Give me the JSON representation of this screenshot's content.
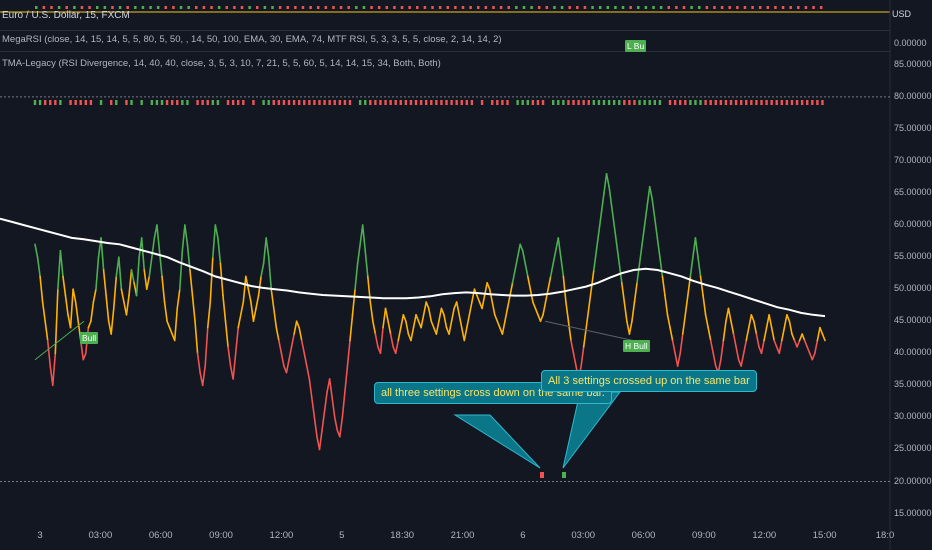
{
  "header": {
    "symbol_line": "Euro / U.S. Dollar, 15, FXCM",
    "indicator1": "MegaRSI (close, 14, 15, 14, 5, 5, 80, 5, 50, , 14, 50, 100, EMA, 30, EMA, 74, MTF RSI, 5, 3, 3, 5, 5, close, 2, 14, 14, 2)",
    "indicator2": "TMA-Legacy (RSI Divergence, 14, 40, 40, close, 3, 5, 3, 10, 7, 21, 5, 5, 60, 5, 14, 14, 15, 34, Both, Both)",
    "currency": "USD",
    "pane2_value": "0.00000"
  },
  "colors": {
    "background": "#131722",
    "ma_line": "#ffffff",
    "bull": "#4caf50",
    "bear": "#f05350",
    "rsi_mid": "#ffb300",
    "callout_bg": "#0c7689",
    "callout_text": "#f5e56b"
  },
  "callouts": {
    "down": "all three settings cross down on the same bar.",
    "up": "All 3 settings crossed up on the same bar"
  },
  "labels": {
    "bull1": "Bull",
    "bull2": "H Bull",
    "bull_top": "L Bu"
  },
  "chart_data": {
    "type": "line",
    "yticks": [
      "85.00000",
      "80.00000",
      "75.00000",
      "70.00000",
      "65.00000",
      "60.00000",
      "55.00000",
      "50.00000",
      "45.00000",
      "40.00000",
      "35.00000",
      "30.00000",
      "25.00000",
      "20.00000",
      "15.00000"
    ],
    "ytick_values": [
      85,
      80,
      75,
      70,
      65,
      60,
      55,
      50,
      45,
      40,
      35,
      30,
      25,
      20,
      15
    ],
    "xticks": [
      "3",
      "03:00",
      "06:00",
      "09:00",
      "12:00",
      "5",
      "18:30",
      "21:00",
      "6",
      "03:00",
      "06:00",
      "09:00",
      "12:00",
      "15:00",
      "18:0"
    ],
    "ylim": [
      14,
      87
    ],
    "hlines": [
      80,
      20
    ],
    "series": [
      {
        "kind": "rsi",
        "values": [
          57,
          55,
          52,
          48,
          45,
          42,
          38,
          35,
          40,
          50,
          56,
          52,
          49,
          46,
          44,
          50,
          48,
          45,
          42,
          39,
          40,
          44,
          45,
          48,
          50,
          55,
          58,
          53,
          49,
          45,
          43,
          47,
          52,
          55,
          50,
          48,
          46,
          49,
          53,
          51,
          49,
          55,
          58,
          53,
          50,
          52,
          55,
          58,
          60,
          56,
          52,
          48,
          45,
          44,
          43,
          42,
          47,
          50,
          56,
          60,
          57,
          53,
          49,
          45,
          40,
          37,
          35,
          38,
          44,
          48,
          55,
          60,
          58,
          54,
          49,
          45,
          41,
          38,
          36,
          40,
          44,
          46,
          48,
          52,
          50,
          48,
          45,
          47,
          49,
          52,
          54,
          58,
          55,
          50,
          47,
          44,
          42,
          40,
          38,
          37,
          39,
          41,
          43,
          45,
          44,
          42,
          40,
          38,
          36,
          33,
          30,
          27,
          25,
          28,
          31,
          34,
          36,
          33,
          30,
          28,
          27,
          30,
          34,
          38,
          42,
          46,
          50,
          54,
          57,
          60,
          56,
          52,
          48,
          45,
          43,
          41,
          40,
          44,
          47,
          45,
          43,
          41,
          40,
          42,
          44,
          46,
          45,
          43,
          42,
          44,
          46,
          45,
          44,
          46,
          48,
          47,
          45,
          44,
          43,
          45,
          47,
          46,
          44,
          43,
          45,
          47,
          48,
          46,
          44,
          42,
          44,
          46,
          48,
          50,
          49,
          48,
          47,
          49,
          51,
          50,
          48,
          46,
          45,
          44,
          43,
          45,
          47,
          49,
          51,
          53,
          55,
          57,
          56,
          54,
          52,
          50,
          48,
          47,
          46,
          45,
          46,
          48,
          50,
          52,
          54,
          56,
          58,
          55,
          52,
          48,
          45,
          42,
          40,
          38,
          36,
          38,
          41,
          44,
          47,
          50,
          53,
          56,
          59,
          62,
          65,
          68,
          66,
          63,
          60,
          57,
          54,
          51,
          48,
          45,
          43,
          45,
          48,
          51,
          54,
          57,
          60,
          63,
          66,
          64,
          61,
          58,
          55,
          52,
          49,
          46,
          44,
          42,
          40,
          38,
          40,
          43,
          46,
          49,
          52,
          55,
          58,
          55,
          52,
          49,
          46,
          44,
          42,
          40,
          38,
          37,
          39,
          42,
          45,
          47,
          45,
          43,
          41,
          39,
          38,
          40,
          42,
          44,
          46,
          45,
          43,
          41,
          40,
          42,
          44,
          46,
          44,
          42,
          41,
          40,
          42,
          44,
          46,
          45,
          43,
          42,
          41,
          42,
          43,
          42,
          41,
          40,
          39,
          40,
          42,
          44,
          43,
          42
        ]
      },
      {
        "kind": "ma",
        "values": [
          61,
          60.5,
          60,
          59.5,
          59,
          58.5,
          58,
          57.8,
          57.5,
          57.2,
          57,
          56.5,
          56,
          55.5,
          55,
          54.2,
          53.5,
          52.8,
          52,
          51.5,
          51,
          50.5,
          50.2,
          50,
          49.8,
          49.5,
          49.3,
          49.1,
          49,
          48.9,
          48.8,
          48.7,
          48.6,
          48.6,
          48.6,
          48.7,
          48.9,
          49.2,
          49.4,
          49.5,
          49.4,
          49.2,
          49.1,
          49,
          49,
          49.1,
          49.3,
          49.6,
          50,
          50.4,
          51,
          51.8,
          52.5,
          53,
          53.2,
          53,
          52.5,
          52,
          51.3,
          50.7,
          50.2,
          49.6,
          49,
          48.4,
          47.8,
          47.2,
          46.8,
          46.3,
          46,
          45.8
        ]
      }
    ]
  }
}
